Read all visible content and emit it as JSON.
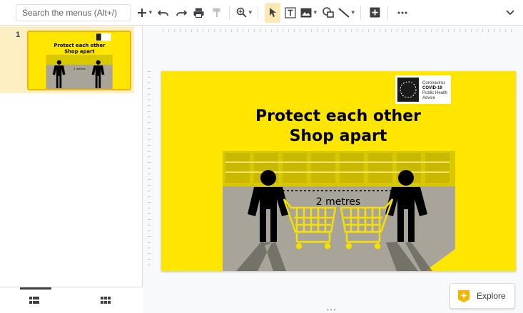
{
  "toolbar": {
    "search_placeholder": "Search the menus (Alt+/)",
    "tools": [
      "add-icon",
      "undo-icon",
      "redo-icon",
      "print-icon",
      "paint-format-icon",
      "zoom-icon",
      "select-icon",
      "textbox-icon",
      "image-icon",
      "shape-icon",
      "line-icon",
      "comment-add-icon",
      "more-icon"
    ]
  },
  "filmstrip": {
    "slides": [
      {
        "number": "1"
      }
    ]
  },
  "slide": {
    "title_line1": "Protect each other",
    "title_line2": "Shop apart",
    "distance_label": "2 metres",
    "logo_line1": "Coronavirus",
    "logo_line2": "COVID-19",
    "logo_line3": "Public Health",
    "logo_line4": "Advice",
    "background_color": "#ffe600",
    "accent_color": "#000000"
  },
  "thumbnail": {
    "title_line1": "Protect each other",
    "title_line2": "Shop apart",
    "distance_label": "2 metres"
  },
  "explore": {
    "label": "Explore"
  }
}
